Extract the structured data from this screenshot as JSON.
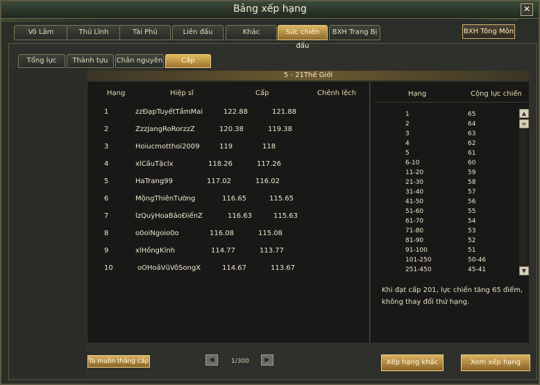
{
  "window": {
    "title": "Bảng xếp hạng"
  },
  "tabs_top": [
    "Võ Lâm",
    "Thủ Lĩnh",
    "Tài Phú",
    "Liên đấu",
    "Khác",
    "Sức chiến đấu",
    "BXH Trang Bị"
  ],
  "bxh_tong_mon": "BXH Tông Môn",
  "tabs_sub": [
    "Tổng lực",
    "Thành tựu",
    "Chân nguyên",
    "Cấp"
  ],
  "group_header": "5 - 21Thế Giới",
  "table": {
    "headers": [
      "Hạng",
      "Hiệp sĩ",
      "Cấp",
      "Chênh lệch"
    ],
    "rows": [
      {
        "rank": "1",
        "name": "zzĐạpTuyếtTầmMai",
        "v1": "122.88",
        "v2": "121.88"
      },
      {
        "rank": "2",
        "name": "ZzzJangRoRorzzZ",
        "v1": "120.38",
        "v2": "119.38"
      },
      {
        "rank": "3",
        "name": "Hoiucmotthoi2009",
        "v1": "119",
        "v2": "118"
      },
      {
        "rank": "4",
        "name": "xlCầuTặclx",
        "v1": "118.26",
        "v2": "117.26"
      },
      {
        "rank": "5",
        "name": "HaTrang99",
        "v1": "117.02",
        "v2": "116.02"
      },
      {
        "rank": "6",
        "name": "MộngThiênTường",
        "v1": "116.65",
        "v2": "115.65"
      },
      {
        "rank": "7",
        "name": "lzQuỳHoaBảoĐiểnZ",
        "v1": "116.63",
        "v2": "115.63"
      },
      {
        "rank": "8",
        "name": "o0oiNgoio0o",
        "v1": "116.08",
        "v2": "115.08"
      },
      {
        "rank": "9",
        "name": "xlHồngKính",
        "v1": "114.77",
        "v2": "113.77"
      },
      {
        "rank": "10",
        "name": "oOHoảVũVôSongX",
        "v1": "114.67",
        "v2": "113.67"
      }
    ]
  },
  "right_table": {
    "headers": [
      "Hạng",
      "Cộng lực chiến"
    ],
    "rows": [
      [
        "1",
        "65"
      ],
      [
        "2",
        "64"
      ],
      [
        "3",
        "63"
      ],
      [
        "4",
        "62"
      ],
      [
        "5",
        "61"
      ],
      [
        "6-10",
        "60"
      ],
      [
        "11-20",
        "59"
      ],
      [
        "21-30",
        "58"
      ],
      [
        "31-40",
        "57"
      ],
      [
        "41-50",
        "56"
      ],
      [
        "51-60",
        "55"
      ],
      [
        "61-70",
        "54"
      ],
      [
        "71-80",
        "53"
      ],
      [
        "81-90",
        "52"
      ],
      [
        "91-100",
        "51"
      ],
      [
        "101-250",
        "50-46"
      ],
      [
        "251-450",
        "45-41"
      ]
    ]
  },
  "note": "Khi đạt cấp 201, lực chiến tăng 65 điểm, không thay đổi thứ hạng.",
  "buttons": {
    "level_up": "Ta muốn thăng cấp",
    "other_ranking": "Xếp hạng khác",
    "view_ranking": "Xem xếp hạng"
  },
  "pagination": {
    "text": "1/300",
    "prev": "◀",
    "next": "▶"
  },
  "colors": {
    "gold_accent": "#d8b161",
    "panel_bg": "#181816"
  }
}
